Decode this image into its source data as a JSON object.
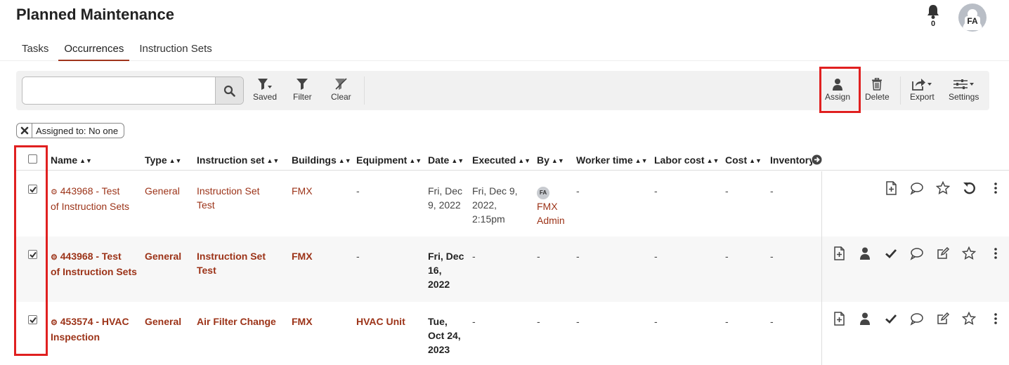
{
  "header": {
    "title": "Planned Maintenance",
    "notifications_count": "0",
    "user_initials": "FA"
  },
  "tabs": [
    {
      "label": "Tasks",
      "active": false
    },
    {
      "label": "Occurrences",
      "active": true
    },
    {
      "label": "Instruction Sets",
      "active": false
    }
  ],
  "toolbar": {
    "search_value": "",
    "saved_label": "Saved",
    "filter_label": "Filter",
    "clear_label": "Clear",
    "assign_label": "Assign",
    "delete_label": "Delete",
    "export_label": "Export",
    "settings_label": "Settings"
  },
  "filter_chip": {
    "label": "Assigned to: No one"
  },
  "columns": [
    "Name",
    "Type",
    "Instruction set",
    "Buildings",
    "Equipment",
    "Date",
    "Executed",
    "By",
    "Worker time",
    "Labor cost",
    "Cost",
    "Inventory"
  ],
  "rows": [
    {
      "name_line1": "443968 - Test",
      "name_line2": "of Instruction Sets",
      "type": "General",
      "instruction_set_line1": "Instruction Set",
      "instruction_set_line2": "Test",
      "buildings": "FMX",
      "equipment": "-",
      "date_line1": "Fri, Dec",
      "date_line2": "9, 2022",
      "date_line3": "",
      "executed_line1": "Fri, Dec 9,",
      "executed_line2": "2022,",
      "executed_line3": "2:15pm",
      "by_initials": "FA",
      "by_line1": "FMX",
      "by_line2": "Admin",
      "worker_time": "-",
      "labor_cost": "-",
      "cost": "-",
      "inventory": "-",
      "bold": false
    },
    {
      "name_line1": "443968 - Test",
      "name_line2": "of Instruction Sets",
      "type": "General",
      "instruction_set_line1": "Instruction Set",
      "instruction_set_line2": "Test",
      "buildings": "FMX",
      "equipment": "-",
      "date_line1": "Fri, Dec",
      "date_line2": "16,",
      "date_line3": "2022",
      "executed": "-",
      "by": "-",
      "worker_time": "-",
      "labor_cost": "-",
      "cost": "-",
      "inventory": "-",
      "bold": true
    },
    {
      "name_line1": "453574 - HVAC",
      "name_line2": "Inspection",
      "type": "General",
      "instruction_set_line1": "Air Filter Change",
      "instruction_set_line2": "",
      "buildings": "FMX",
      "equipment": "HVAC Unit",
      "date_line1": "Tue,",
      "date_line2": "Oct 24,",
      "date_line3": "2023",
      "executed": "-",
      "by": "-",
      "worker_time": "-",
      "labor_cost": "-",
      "cost": "-",
      "inventory": "-",
      "bold": true
    }
  ],
  "colors": {
    "accent": "#9c3318",
    "highlight": "#e02020",
    "toolbar_bg": "#f1f1f1"
  }
}
